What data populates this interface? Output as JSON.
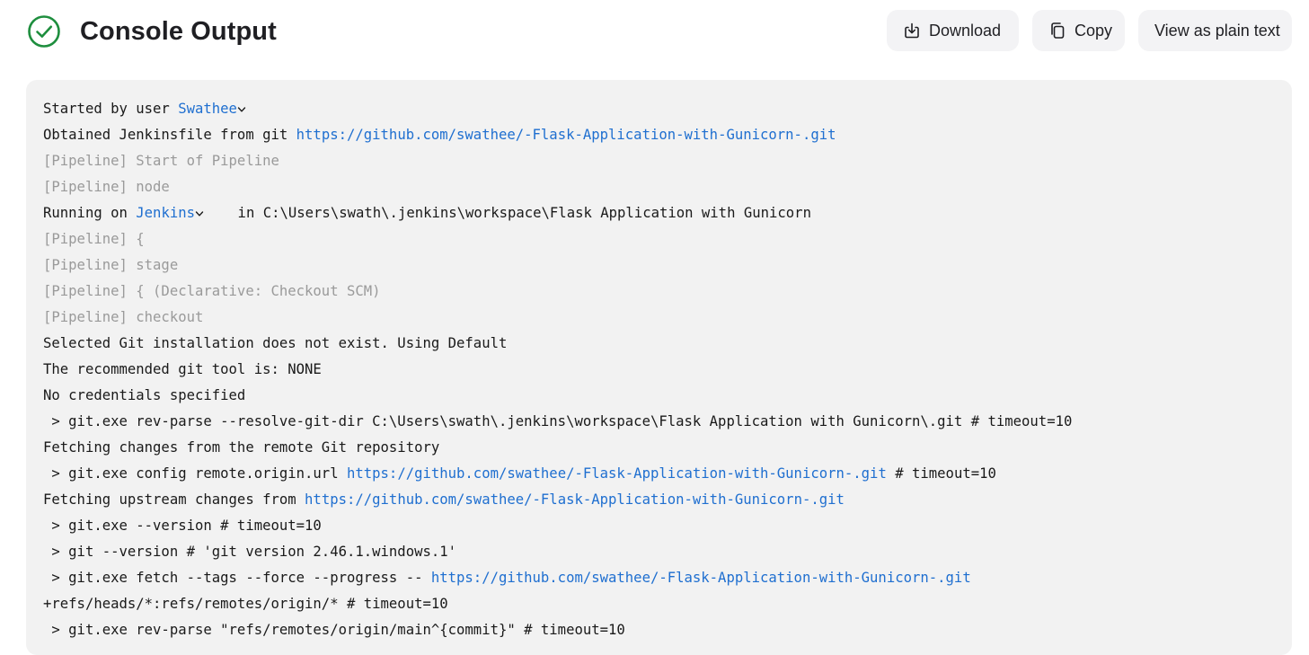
{
  "header": {
    "title": "Console Output",
    "status_icon": "check-circle-icon",
    "status_color": "#1e8e3e"
  },
  "actions": {
    "download_label": "Download",
    "copy_label": "Copy",
    "plain_text_label": "View as plain text"
  },
  "console": {
    "line1_prefix": "Started by user ",
    "line1_user": "Swathee",
    "line2_prefix": "Obtained Jenkinsfile from git ",
    "line2_url": "https://github.com/swathee/-Flask-Application-with-Gunicorn-.git",
    "line3": "[Pipeline] Start of Pipeline",
    "line4": "[Pipeline] node",
    "line5_prefix": "Running on ",
    "line5_agent": "Jenkins",
    "line5_suffix": "    in C:\\Users\\swath\\.jenkins\\workspace\\Flask Application with Gunicorn",
    "line6": "[Pipeline] {",
    "line7": "[Pipeline] stage",
    "line8": "[Pipeline] { (Declarative: Checkout SCM)",
    "line9": "[Pipeline] checkout",
    "line10": "Selected Git installation does not exist. Using Default",
    "line11": "The recommended git tool is: NONE",
    "line12": "No credentials specified",
    "line13": " > git.exe rev-parse --resolve-git-dir C:\\Users\\swath\\.jenkins\\workspace\\Flask Application with Gunicorn\\.git # timeout=10",
    "line14": "Fetching changes from the remote Git repository",
    "line15_prefix": " > git.exe config remote.origin.url ",
    "line15_url": "https://github.com/swathee/-Flask-Application-with-Gunicorn-.git",
    "line15_suffix": " # timeout=10",
    "line16_prefix": "Fetching upstream changes from ",
    "line16_url": "https://github.com/swathee/-Flask-Application-with-Gunicorn-.git",
    "line17": " > git.exe --version # timeout=10",
    "line18": " > git --version # 'git version 2.46.1.windows.1'",
    "line19_prefix": " > git.exe fetch --tags --force --progress -- ",
    "line19_url": "https://github.com/swathee/-Flask-Application-with-Gunicorn-.git",
    "line20": "+refs/heads/*:refs/remotes/origin/* # timeout=10",
    "line21": " > git.exe rev-parse \"refs/remotes/origin/main^{commit}\" # timeout=10"
  },
  "colors": {
    "link": "#1f6fd0",
    "muted": "#9a9a9a",
    "console_bg": "#f2f2f2",
    "button_bg": "#f3f3f5"
  }
}
